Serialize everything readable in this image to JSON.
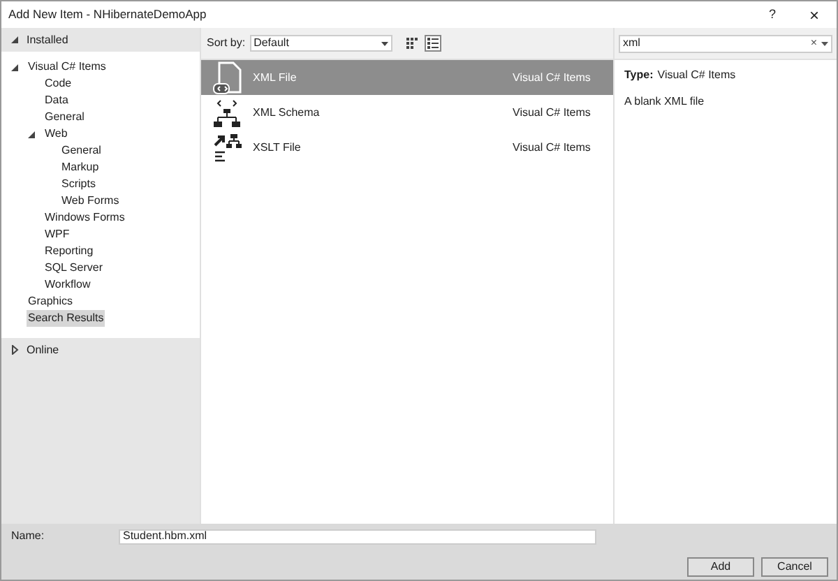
{
  "window": {
    "title": "Add New Item - NHibernateDemoApp",
    "help": "?",
    "close": "×"
  },
  "sidebar": {
    "sections": [
      {
        "label": "Installed",
        "expanded": true,
        "items": [
          {
            "label": "Visual C# Items",
            "expanded": true,
            "selected": false,
            "children": [
              {
                "label": "Code",
                "selected": false
              },
              {
                "label": "Data",
                "selected": false
              },
              {
                "label": "General",
                "selected": false
              },
              {
                "label": "Web",
                "expanded": true,
                "selected": false,
                "children": [
                  {
                    "label": "General",
                    "selected": false
                  },
                  {
                    "label": "Markup",
                    "selected": false
                  },
                  {
                    "label": "Scripts",
                    "selected": false
                  },
                  {
                    "label": "Web Forms",
                    "selected": false
                  }
                ]
              },
              {
                "label": "Windows Forms",
                "selected": false
              },
              {
                "label": "WPF",
                "selected": false
              },
              {
                "label": "Reporting",
                "selected": false
              },
              {
                "label": "SQL Server",
                "selected": false
              },
              {
                "label": "Workflow",
                "selected": false
              }
            ]
          },
          {
            "label": "Graphics",
            "selected": false
          },
          {
            "label": "Search Results",
            "selected": true
          }
        ]
      },
      {
        "label": "Online",
        "expanded": false
      }
    ]
  },
  "toolbar": {
    "sort_label": "Sort by:",
    "sort_value": "Default",
    "view_buttons": [
      {
        "kind": "grid",
        "selected": false
      },
      {
        "kind": "list",
        "selected": true
      }
    ]
  },
  "search": {
    "value": "xml",
    "clear": "×"
  },
  "templates": [
    {
      "kind": "xml",
      "name": "XML File",
      "category": "Visual C# Items",
      "selected": true
    },
    {
      "kind": "schema",
      "name": "XML Schema",
      "category": "Visual C# Items",
      "selected": false
    },
    {
      "kind": "xslt",
      "name": "XSLT File",
      "category": "Visual C# Items",
      "selected": false
    }
  ],
  "details": {
    "type_label": "Type:",
    "type_value": "Visual C# Items",
    "description": "A blank XML file"
  },
  "footer": {
    "name_label": "Name:",
    "name_value": "Student.hbm.xml",
    "buttons": [
      "Add",
      "Cancel"
    ]
  }
}
